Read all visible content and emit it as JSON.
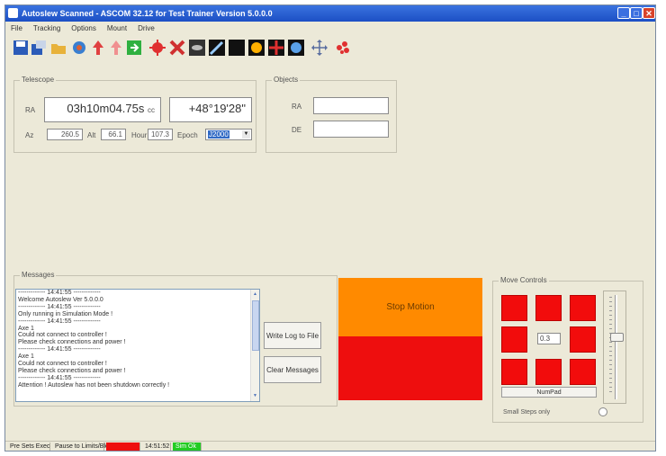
{
  "window": {
    "title": "Autoslew Scanned - ASCOM 32.12 for Test Trainer Version 5.0.0.0",
    "colors": {
      "titlebar": "#1c4fc4",
      "orange": "#ff8a00",
      "red": "#ee0e0e",
      "green": "#22cc22"
    }
  },
  "menu": [
    "File",
    "Tracking",
    "Options",
    "Mount",
    "Drive"
  ],
  "toolbar_icons": [
    "save-icon",
    "connect-icon",
    "open-folder-icon",
    "sync-icon",
    "up-arrow-icon",
    "park-icon",
    "exit-icon",
    "crosshair-icon",
    "satellite-icon",
    "galaxy-icon",
    "comet-icon",
    "moon-icon",
    "sun-icon",
    "star-icon",
    "planet-icon",
    "move-icon",
    "cluster-icon"
  ],
  "telescope": {
    "label": "Telescope",
    "ra_label": "RA",
    "ra_value": "03h10m04.75s",
    "ra_unit": "cc",
    "dec_value": "+48°19'28\"",
    "az_label": "Az",
    "az_value": "260.5",
    "alt_label": "Alt",
    "alt_value": "66.1",
    "hour_label": "Hour",
    "hour_value": "107.3",
    "epoch_label": "Epoch",
    "epoch_value": "J2000"
  },
  "objects": {
    "label": "Objects",
    "ra_label": "RA",
    "dec_label": "DE",
    "ra_value": "",
    "dec_value": ""
  },
  "messages": {
    "label": "Messages",
    "lines": [
      "------------- 14:41:55 -------------",
      "Welcome Autoslew Ver 5.0.0.0",
      "------------- 14:41:55 -------------",
      "Only running in Simulation Mode !",
      "------------- 14:41:55 -------------",
      "Axe 1",
      "Could not connect to controller !",
      "Please check connections and power !",
      "------------- 14:41:55 -------------",
      "Axe 1",
      "Could not connect to controller !",
      "Please check connections and power !",
      "------------- 14:41:55 -------------",
      "Attention ! Autoslew has not been shutdown correctly !"
    ],
    "write_button": "Write Log to File",
    "clear_button": "Clear Messages"
  },
  "control": {
    "stop_label": "Stop Motion",
    "red_label": ""
  },
  "move_controls": {
    "label": "Move Controls",
    "speed_value": "0.3",
    "numpad_button": "NumPad",
    "small_steps_label": "Small Steps only"
  },
  "statusbar": {
    "items": [
      {
        "text": "Pre Sets Exec",
        "bg": "#ece9d8"
      },
      {
        "text": "Pause to Limits/Ble",
        "bg": "#ece9d8"
      },
      {
        "text": "",
        "bg": "#ee0e0e"
      },
      {
        "text": "14:51:52",
        "bg": "#ece9d8"
      },
      {
        "text": "Sim Ok",
        "bg": "#22cc22"
      }
    ]
  }
}
